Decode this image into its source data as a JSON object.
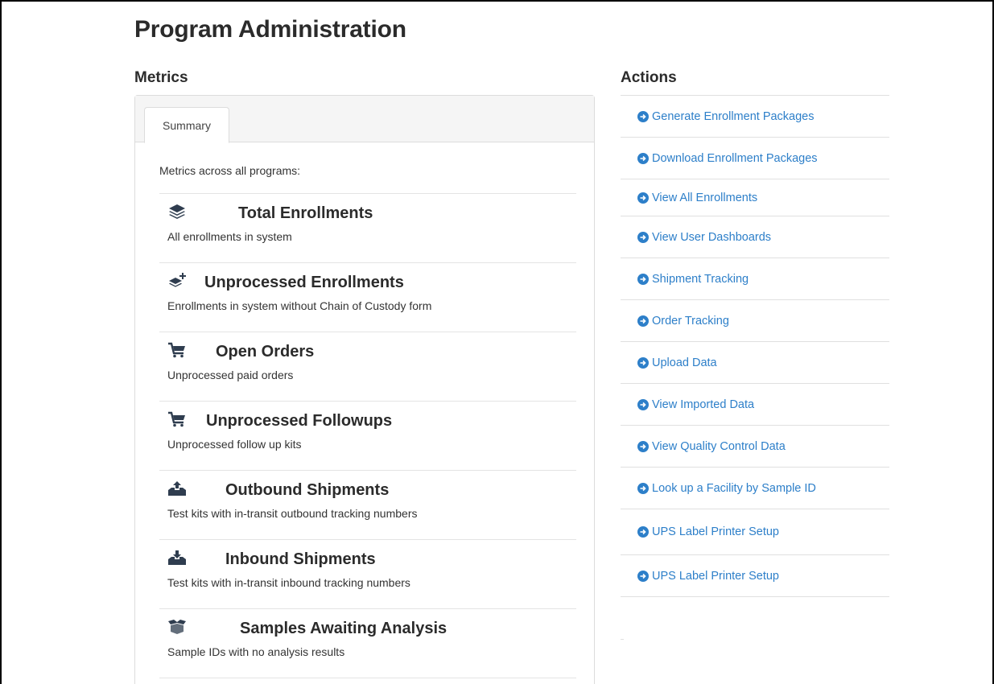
{
  "page": {
    "title": "Program Administration"
  },
  "metrics": {
    "heading": "Metrics",
    "tabs": [
      {
        "label": "Summary"
      }
    ],
    "intro": "Metrics across all programs:",
    "items": [
      {
        "icon": "layers-icon",
        "title": "Total Enrollments",
        "description": "All enrollments in system"
      },
      {
        "icon": "layers-plus-icon",
        "title": "Unprocessed Enrollments",
        "description": "Enrollments in system without Chain of Custody form"
      },
      {
        "icon": "cart-icon",
        "title": "Open Orders",
        "description": "Unprocessed paid orders"
      },
      {
        "icon": "cart-icon",
        "title": "Unprocessed Followups",
        "description": "Unprocessed follow up kits"
      },
      {
        "icon": "tray-upload-icon",
        "title": "Outbound Shipments",
        "description": "Test kits with in-transit outbound tracking numbers"
      },
      {
        "icon": "tray-download-icon",
        "title": "Inbound Shipments",
        "description": "Test kits with in-transit inbound tracking numbers"
      },
      {
        "icon": "open-box-icon",
        "title": "Samples Awaiting Analysis",
        "description": "Sample IDs with no analysis results"
      }
    ]
  },
  "actions": {
    "heading": "Actions",
    "icon": "circle-arrow-right-icon",
    "accent_color": "#2d7fc9",
    "items": [
      {
        "label": "Generate Enrollment Packages"
      },
      {
        "label": "Download Enrollment Packages"
      },
      {
        "label": "View All Enrollments"
      },
      {
        "label": "View User Dashboards"
      },
      {
        "label": "Shipment Tracking"
      },
      {
        "label": "Order Tracking"
      },
      {
        "label": "Upload Data"
      },
      {
        "label": "View Imported Data"
      },
      {
        "label": "View Quality Control Data"
      },
      {
        "label": "Look up a Facility by Sample ID"
      },
      {
        "label": "UPS Label Printer Setup"
      },
      {
        "label": "UPS Label Printer Setup"
      }
    ]
  }
}
